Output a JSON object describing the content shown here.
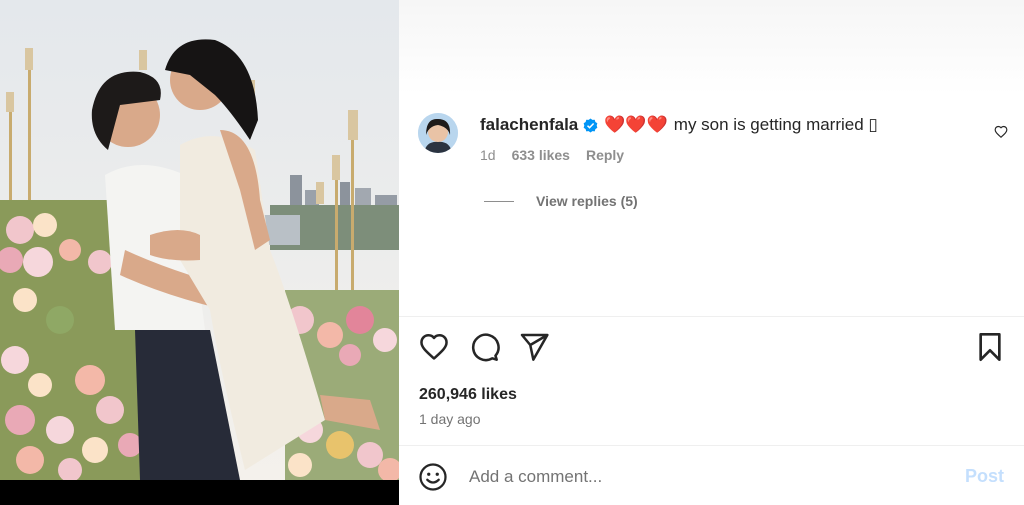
{
  "post": {
    "image_alt": "couple embracing among flowers and candles",
    "likes_text": "260,946 likes",
    "time_ago": "1 day ago"
  },
  "comment": {
    "username": "falachenfala",
    "hearts": "❤️❤️❤️",
    "text": "my son is getting married ▯",
    "age": "1d",
    "likes": "633 likes",
    "reply_label": "Reply",
    "view_replies": "View replies (5)"
  },
  "comment_bar": {
    "placeholder": "Add a comment...",
    "post_label": "Post"
  },
  "icons": {
    "verified": "verified-badge-icon",
    "comment_like": "heart-outline-icon",
    "like": "heart-outline-icon",
    "comment": "speech-bubble-icon",
    "share": "paper-plane-icon",
    "save": "bookmark-icon",
    "emoji": "smiley-face-icon"
  },
  "colors": {
    "verified_blue": "#0095f6",
    "heart_red": "#ed1c24",
    "post_disabled": "#c4dffd",
    "secondary_text": "#737373"
  }
}
